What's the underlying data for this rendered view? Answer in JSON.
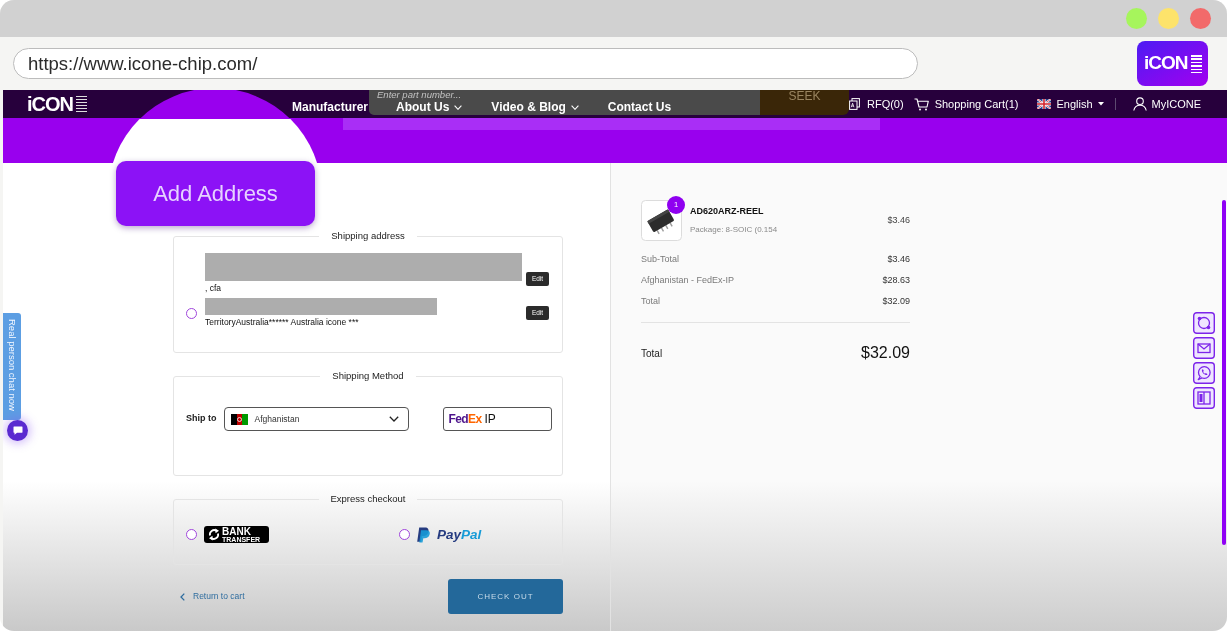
{
  "browser": {
    "window_controls": [
      {
        "color": "#a6f55c"
      },
      {
        "color": "#fde36b"
      },
      {
        "color": "#f26a6a"
      }
    ],
    "url": "https://www.icone-chip.com/",
    "extension_logo": "iCON"
  },
  "navbar": {
    "logo": "iCON",
    "menu": [
      {
        "label": "Manufacturer",
        "dropdown": false
      },
      {
        "label": "About Us",
        "dropdown": true
      },
      {
        "label": "Video & Blog",
        "dropdown": true
      },
      {
        "label": "Contact Us",
        "dropdown": false
      }
    ],
    "search": {
      "placeholder": "Enter part number...",
      "button": "SEEK"
    },
    "rfq": "RFQ(0)",
    "cart": "Shopping Cart(1)",
    "language": "English",
    "account": "MyICONE"
  },
  "magnifier": {
    "button": "Add Address"
  },
  "shipping_address": {
    "legend": "Shipping address",
    "addresses": [
      {
        "kind": "wide",
        "text": ", cfa",
        "edit": "Edit"
      },
      {
        "kind": "narrow",
        "radio": {
          "selected": false
        },
        "text": "TerritoryAustralia****** Australia icone ***",
        "edit": "Edit"
      }
    ]
  },
  "shipping_method": {
    "legend": "Shipping Method",
    "ship_to_label": "Ship to",
    "country": "Afghanistan",
    "carrier": {
      "brand": [
        "Fed",
        "Ex"
      ],
      "service": "IP"
    }
  },
  "express_checkout": {
    "legend": "Express checkout",
    "options": [
      {
        "kind": "bank",
        "lines": [
          "BANK",
          "TRANSFER"
        ],
        "selected": false
      },
      {
        "kind": "paypal",
        "wordmark": [
          "Pay",
          "Pal"
        ],
        "selected": false
      }
    ]
  },
  "actions": {
    "return_link": "Return to cart",
    "checkout": "CHECK OUT"
  },
  "summary": {
    "items": [
      {
        "name": "AD620ARZ-REEL",
        "package": "Package: 8-SOIC (0.154",
        "price": "$3.46",
        "quantity": "1"
      }
    ],
    "lines": [
      {
        "label": "Sub-Total",
        "value": "$3.46"
      },
      {
        "label": "Afghanistan - FedEx-IP",
        "value": "$28.63"
      },
      {
        "label": "Total",
        "value": "$32.09"
      }
    ],
    "total": {
      "label": "Total",
      "value": "$32.09"
    }
  },
  "chat_tab": {
    "label": "Real person chat now"
  }
}
